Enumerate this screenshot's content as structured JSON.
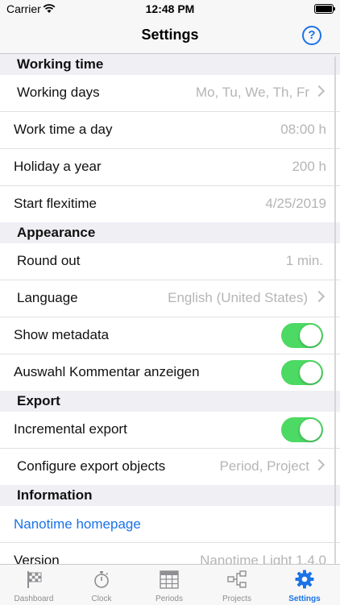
{
  "status_bar": {
    "carrier": "Carrier",
    "time": "12:48 PM"
  },
  "nav": {
    "title": "Settings",
    "help_icon": "help-circle-icon",
    "help_glyph": "?"
  },
  "sections": {
    "working_time": {
      "title": "Working time",
      "working_days": {
        "label": "Working days",
        "value": "Mo, Tu, We, Th, Fr"
      },
      "work_time": {
        "label": "Work time a day",
        "value": "08:00 h"
      },
      "holiday": {
        "label": "Holiday a year",
        "value": "200 h"
      },
      "flexitime": {
        "label": "Start flexitime",
        "value": "4/25/2019"
      }
    },
    "appearance": {
      "title": "Appearance",
      "round_out": {
        "label": "Round out",
        "value": "1 min."
      },
      "language": {
        "label": "Language",
        "value": "English (United States)"
      },
      "show_metadata": {
        "label": "Show metadata",
        "on": true
      },
      "comment_selection": {
        "label": "Auswahl Kommentar anzeigen",
        "on": true
      }
    },
    "export": {
      "title": "Export",
      "incremental": {
        "label": "Incremental export",
        "on": true
      },
      "configure": {
        "label": "Configure export objects",
        "value": "Period, Project"
      }
    },
    "information": {
      "title": "Information",
      "homepage": {
        "label": "Nanotime homepage"
      },
      "version": {
        "label": "Version",
        "value": "Nanotime Light 1.4.0"
      }
    }
  },
  "tabs": [
    {
      "label": "Dashboard",
      "icon": "checkered-flag-icon",
      "active": false
    },
    {
      "label": "Clock",
      "icon": "stopwatch-icon",
      "active": false
    },
    {
      "label": "Periods",
      "icon": "calendar-grid-icon",
      "active": false
    },
    {
      "label": "Projects",
      "icon": "project-tree-icon",
      "active": false
    },
    {
      "label": "Settings",
      "icon": "gear-icon",
      "active": true
    }
  ],
  "colors": {
    "accent": "#1a73e8",
    "toggle_on": "#4cd964",
    "value_gray": "#b5b5b5",
    "section_bg": "#efeff4"
  }
}
